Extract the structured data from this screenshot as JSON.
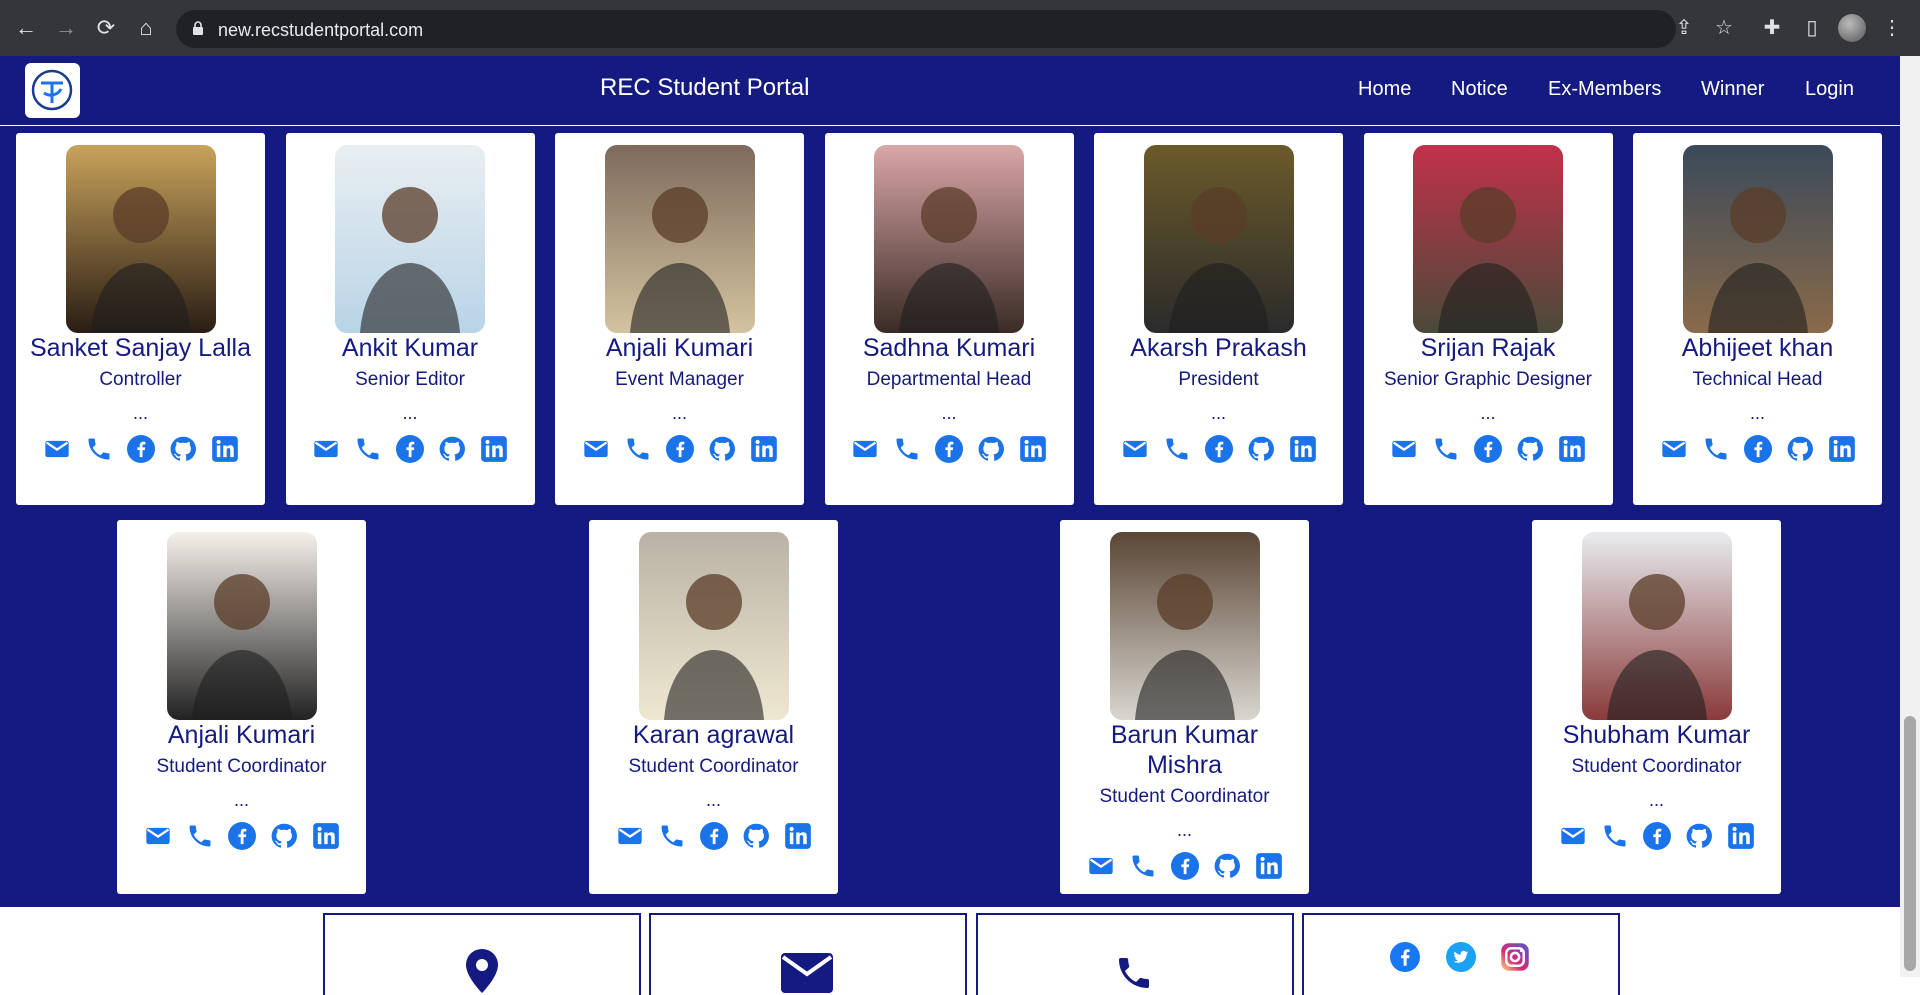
{
  "browser": {
    "url": "new.recstudentportal.com"
  },
  "site": {
    "title": "REC Student Portal",
    "nav": [
      "Home",
      "Notice",
      "Ex-Members",
      "Winner",
      "Login"
    ],
    "brand_color": "#141a80",
    "icon_color": "#1a73e8"
  },
  "members_row1": [
    {
      "name": "Sanket Sanjay Lalla",
      "role": "Controller",
      "more": "..."
    },
    {
      "name": "Ankit Kumar",
      "role": "Senior Editor",
      "more": "..."
    },
    {
      "name": "Anjali Kumari",
      "role": "Event Manager",
      "more": "..."
    },
    {
      "name": "Sadhna Kumari",
      "role": "Departmental Head",
      "more": "..."
    },
    {
      "name": "Akarsh Prakash",
      "role": "President",
      "more": "..."
    },
    {
      "name": "Srijan Rajak",
      "role": "Senior Graphic Designer",
      "more": "..."
    },
    {
      "name": "Abhijeet khan",
      "role": "Technical Head",
      "more": "..."
    }
  ],
  "members_row2": [
    {
      "name": "Anjali Kumari",
      "role": "Student Coordinator",
      "more": "..."
    },
    {
      "name": "Karan agrawal",
      "role": "Student Coordinator",
      "more": "..."
    },
    {
      "name": "Barun Kumar Mishra",
      "role": "Student Coordinator",
      "more": "..."
    },
    {
      "name": "Shubham Kumar",
      "role": "Student Coordinator",
      "more": "..."
    }
  ],
  "contact_icons": [
    "mail-icon",
    "phone-icon",
    "facebook-icon",
    "github-icon",
    "linkedin-icon"
  ],
  "footer": {
    "boxes": [
      "location-icon",
      "mail-icon",
      "phone-icon",
      "social-icons"
    ],
    "social": [
      "facebook-icon",
      "twitter-icon",
      "instagram-icon"
    ]
  }
}
